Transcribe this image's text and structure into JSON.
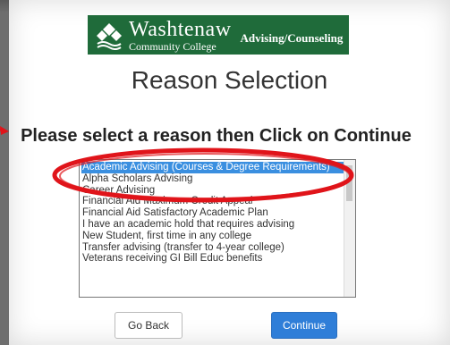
{
  "header": {
    "college_name": "Washtenaw",
    "college_sub": "Community College",
    "department": "Advising/Counseling"
  },
  "title": "Reason Selection",
  "instruction": "Please select a reason then Click on Continue",
  "reasons": {
    "selected_index": 0,
    "options": [
      "Academic Advising (Courses & Degree Requirements)",
      "Alpha Scholars Advising",
      "Career Advising",
      "Financial Aid Maximum Credit Appeal",
      "Financial Aid Satisfactory Academic Plan",
      "I have an academic hold that requires advising",
      "New Student, first time in any college",
      "Transfer advising (transfer to 4-year college)",
      "Veterans receiving GI Bill Educ benefits"
    ]
  },
  "buttons": {
    "back": "Go Back",
    "continue": "Continue"
  },
  "colors": {
    "brand_green": "#1f6b3a",
    "selection_blue": "#3a8fe0",
    "annotation_red": "#e0141a",
    "primary_button": "#2f7ed8"
  }
}
